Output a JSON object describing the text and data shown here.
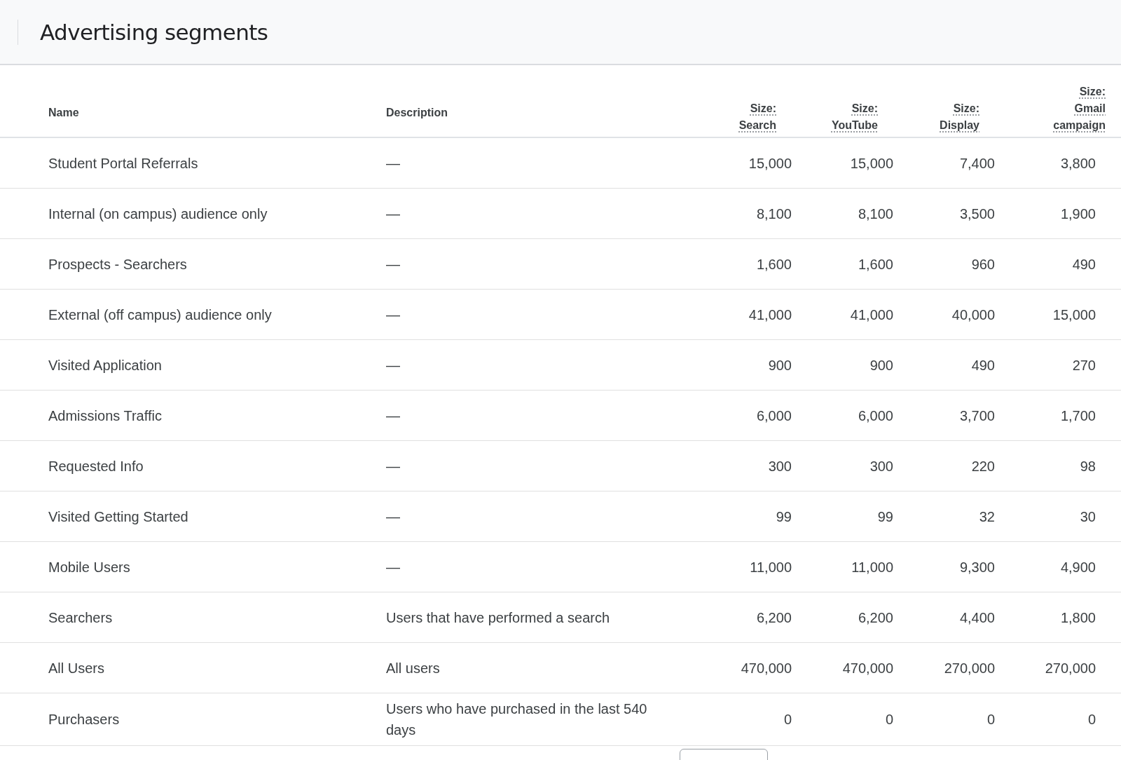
{
  "title": "Advertising segments",
  "table": {
    "columns": [
      {
        "label": "Name",
        "kind": "text"
      },
      {
        "label": "Description",
        "kind": "text"
      },
      {
        "label": "Size: Search",
        "kind": "size"
      },
      {
        "label": "Size: YouTube",
        "kind": "size"
      },
      {
        "label": "Size: Display",
        "kind": "size"
      },
      {
        "label": "Size: Gmail campaign",
        "kind": "size"
      }
    ],
    "rows": [
      [
        "Student Portal Referrals",
        "—",
        "15,000",
        "15,000",
        "7,400",
        "3,800"
      ],
      [
        "Internal (on campus) audience only",
        "—",
        "8,100",
        "8,100",
        "3,500",
        "1,900"
      ],
      [
        "Prospects - Searchers",
        "—",
        "1,600",
        "1,600",
        "960",
        "490"
      ],
      [
        "External (off campus) audience only",
        "—",
        "41,000",
        "41,000",
        "40,000",
        "15,000"
      ],
      [
        "Visited Application",
        "—",
        "900",
        "900",
        "490",
        "270"
      ],
      [
        "Admissions Traffic",
        "—",
        "6,000",
        "6,000",
        "3,700",
        "1,700"
      ],
      [
        "Requested Info",
        "—",
        "300",
        "300",
        "220",
        "98"
      ],
      [
        "Visited Getting Started",
        "—",
        "99",
        "99",
        "32",
        "30"
      ],
      [
        "Mobile Users",
        "—",
        "11,000",
        "11,000",
        "9,300",
        "4,900"
      ],
      [
        "Searchers",
        "Users that have performed a search",
        "6,200",
        "6,200",
        "4,400",
        "1,800"
      ],
      [
        "All Users",
        "All users",
        "470,000",
        "470,000",
        "270,000",
        "270,000"
      ],
      [
        "Purchasers",
        "Users who have purchased in the last 540 days",
        "0",
        "0",
        "0",
        "0"
      ]
    ]
  }
}
